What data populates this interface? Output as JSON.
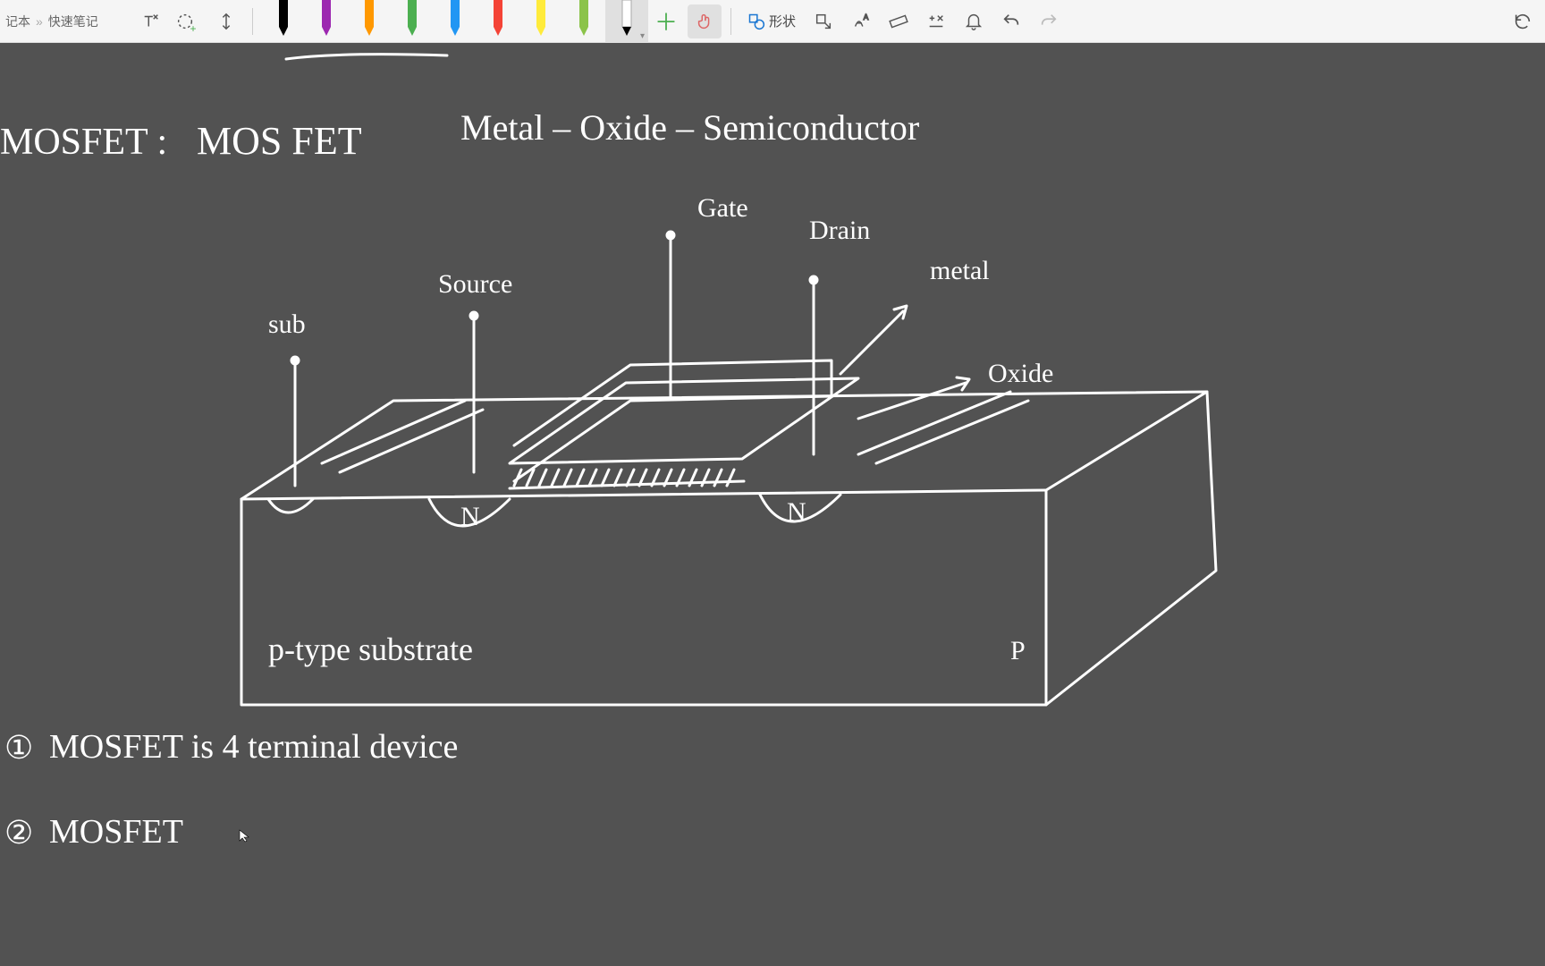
{
  "breadcrumb": {
    "notebook": "记本",
    "sep": "»",
    "page": "快速笔记"
  },
  "toolbar": {
    "shape_label": "形状",
    "pen_colors": [
      "#000000",
      "#9c27b0",
      "#ff9800",
      "#4caf50",
      "#2196f3",
      "#f44336",
      "#ffeb3b",
      "#8bc34a",
      "#ffffff",
      "#000000"
    ],
    "selected_pen_index": 8
  },
  "notes": {
    "title_left": "MOSFET :",
    "title_mid": "MOS FET",
    "title_right": "Metal – Oxide – Semiconductor",
    "label_sub": "sub",
    "label_source": "Source",
    "label_gate": "Gate",
    "label_drain": "Drain",
    "label_metal": "metal",
    "label_oxide": "Oxide",
    "label_n1": "N",
    "label_n2": "N",
    "label_p": "P",
    "label_ptype": "p-type substrate",
    "bullet1_num": "①",
    "bullet1_text": "MOSFET is 4 terminal device",
    "bullet2_num": "②",
    "bullet2_text": "MOSFET"
  }
}
